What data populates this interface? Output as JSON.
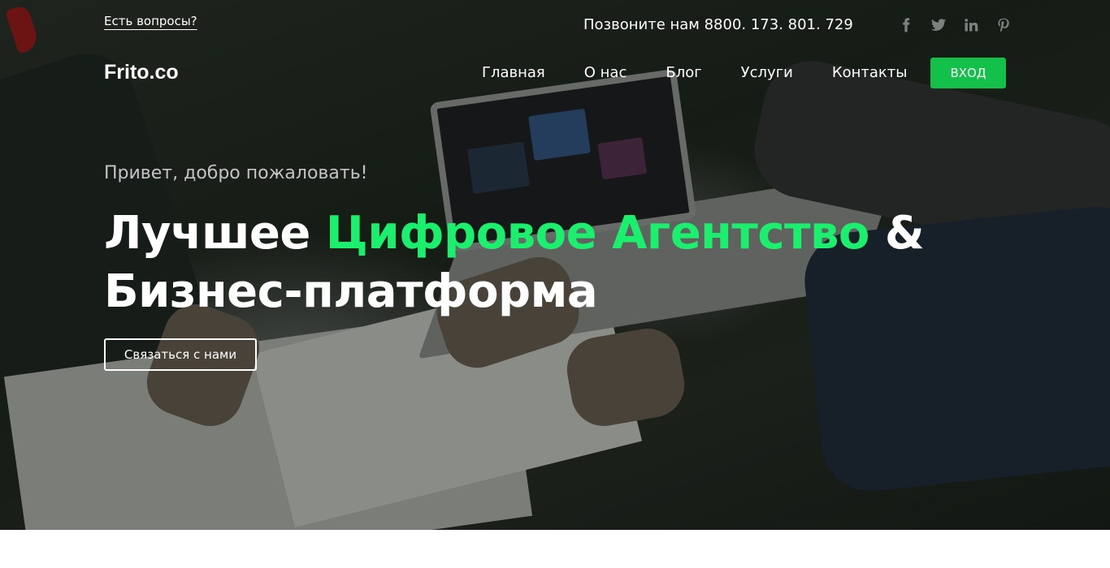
{
  "topbar": {
    "question_link": "Есть вопросы?",
    "phone": "Позвоните нам 8800. 173. 801. 729",
    "socials": [
      {
        "icon": "facebook-icon"
      },
      {
        "icon": "twitter-icon"
      },
      {
        "icon": "linkedin-icon"
      },
      {
        "icon": "pinterest-icon"
      }
    ]
  },
  "header": {
    "logo": "Frito.co",
    "nav": [
      "Главная",
      "О нас",
      "Блог",
      "Услуги",
      "Контакты"
    ],
    "login_label": "ВХОД"
  },
  "hero": {
    "welcome": "Привет, добро пожаловать!",
    "headline_part1": "Лучшее ",
    "headline_accent": "Цифровое Агентство",
    "headline_part2": " & Бизнес-платформа",
    "cta_label": "Связаться с нами"
  },
  "colors": {
    "accent": "#1bf06e",
    "login_button": "#13c14a",
    "social_icon": "#7e807e"
  }
}
